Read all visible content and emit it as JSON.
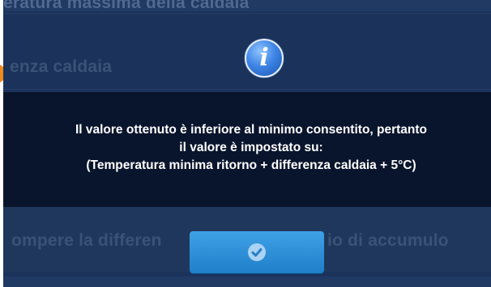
{
  "background": {
    "row_1": "eratura massima della caldaia",
    "row_2": "enza caldaia",
    "row_3_left": "ompere la differen",
    "row_3_right": "io di accumulo"
  },
  "dialog": {
    "icon": "info-icon",
    "message_lines": [
      "Il valore ottenuto è inferiore al minimo consentito, pertanto",
      "il valore è impostato su:",
      "(Temperatura minima ritorno + differenza caldaia + 5°C)"
    ],
    "ok_button_icon": "check-icon"
  },
  "colors": {
    "screen_bg": "#203a64",
    "message_band": "#09152c",
    "button": "#2c8fd6",
    "marker": "#f08a1c"
  }
}
